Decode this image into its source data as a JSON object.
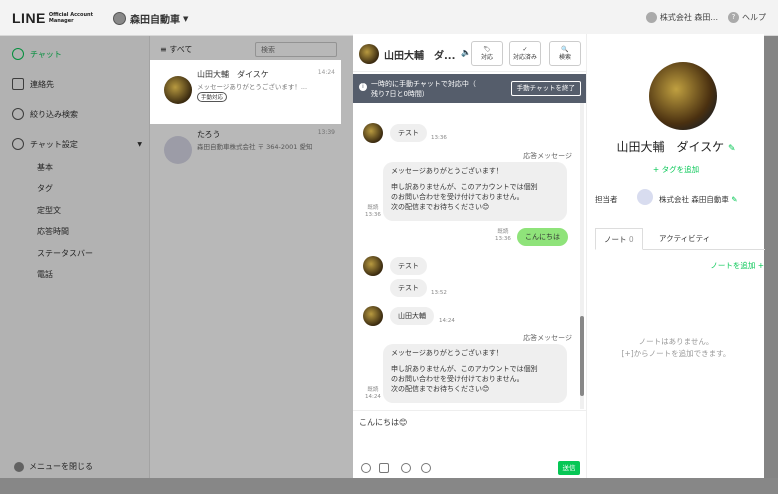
{
  "topbar": {
    "logo": "LINE",
    "logo_sub_1": "Official Account",
    "logo_sub_2": "Manager",
    "account_name": "森田自動車",
    "user_name": "株式会社 森田...",
    "help": "ヘルプ"
  },
  "sidebar": {
    "chat": "チャット",
    "contacts": "連絡先",
    "filter": "絞り込み検索",
    "chat_settings": "チャット設定",
    "sub_items": [
      "基本",
      "タグ",
      "定型文",
      "応答時間",
      "ステータスバー",
      "電話"
    ],
    "menu_close": "メニューを閉じる"
  },
  "chatlist": {
    "filter_label": "すべて",
    "search_placeholder": "検索",
    "items": [
      {
        "name": "山田大輔　ダイスケ",
        "message": "メッセージありがとうございます！...",
        "time": "14:24",
        "badge": "手動対応"
      },
      {
        "name": "たろう",
        "message": "森田自動車株式会社 〒 364-2001 愛知",
        "time": "13:39"
      }
    ]
  },
  "chatroom": {
    "name": "山田大輔　ダ...",
    "btn_assign": "対応",
    "btn_done": "対応済み",
    "btn_search": "検索",
    "banner_line1": "一時的に手動チャットで対応中（",
    "banner_line2": "残り7日と0時間）",
    "banner_button": "手動チャットを終了",
    "messages": [
      {
        "text": "テスト",
        "time": "13:36"
      },
      {
        "label": "応答メッセージ"
      },
      {
        "text": "メッセージありがとうございます！",
        "time": "13:36",
        "read": "既読"
      },
      {
        "text": "申し訳ありませんが、このアカウントでは個別"
      },
      {
        "text": "のお問い合わせを受け付けておりません。"
      },
      {
        "text": "次の配信までお待ちください😊"
      },
      {
        "text": "こんにちは",
        "time": "13:36",
        "read": "既読"
      },
      {
        "text": "テスト"
      },
      {
        "text": "テスト",
        "time": "13:52"
      },
      {
        "text": "山田大輔",
        "time": "14:24"
      },
      {
        "label": "応答メッセージ"
      },
      {
        "text": "メッセージありがとうございます！",
        "time": "14:24",
        "read": "既読"
      },
      {
        "text": "申し訳ありませんが、このアカウントでは個別"
      },
      {
        "text": "のお問い合わせを受け付けておりません。"
      },
      {
        "text": "次の配信までお待ちください😊"
      }
    ],
    "input_value": "こんにちは😊",
    "send": "送信"
  },
  "profile": {
    "name": "山田大輔　ダイスケ",
    "add_tag": "+ タグを追加",
    "assignee_label": "担当者",
    "assignee_name": "株式会社 森田自動車",
    "tab_note": "ノート",
    "tab_note_count": "0",
    "tab_activity": "アクティビティ",
    "add_note": "ノートを追加 +",
    "empty_1": "ノートはありません。",
    "empty_2": "[+]からノートを追加できます。"
  },
  "colors": {
    "accent": "#06c755",
    "banner": "#555d6b",
    "bubble_green": "#8fe37a"
  }
}
